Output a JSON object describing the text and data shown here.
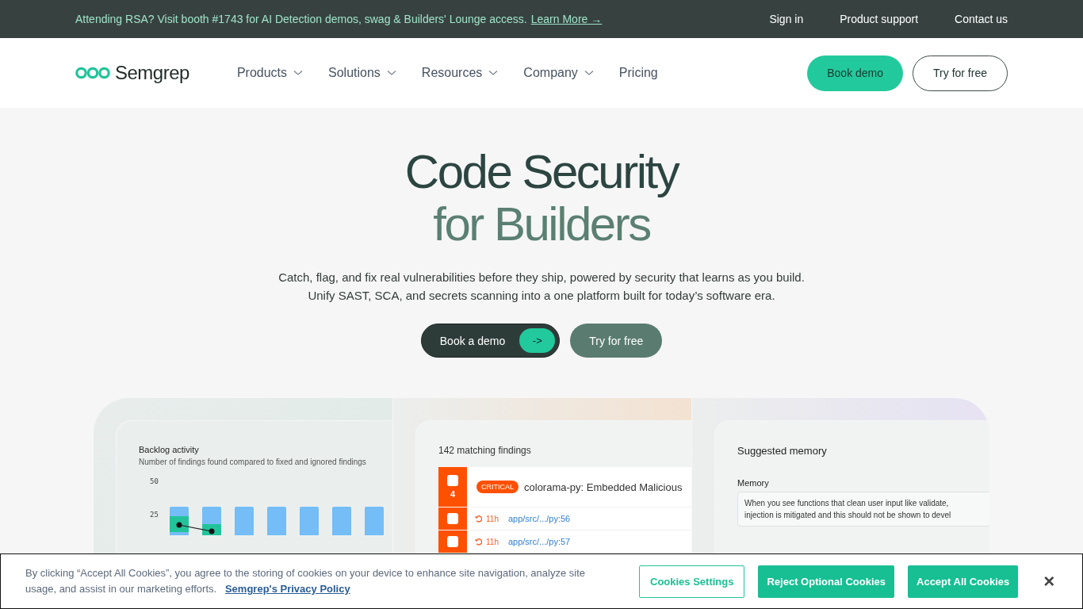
{
  "announcement": {
    "text": "Attending RSA? Visit booth #1743 for AI Detection demos, swag & Builders' Lounge access.",
    "link": "Learn More →"
  },
  "top_links": [
    "Sign in",
    "Product support",
    "Contact us"
  ],
  "brand": "Semgrep",
  "nav": [
    {
      "label": "Products",
      "dropdown": true
    },
    {
      "label": "Solutions",
      "dropdown": true
    },
    {
      "label": "Resources",
      "dropdown": true
    },
    {
      "label": "Company",
      "dropdown": true
    },
    {
      "label": "Pricing",
      "dropdown": false
    }
  ],
  "nav_buttons": {
    "primary": "Book demo",
    "secondary": "Try for free"
  },
  "hero": {
    "title_line_1": "Code Security",
    "title_line_2": "for Builders",
    "subtitle_line_1": "Catch, flag, and fix real vulnerabilities before they ship, powered by security that learns as you build.",
    "subtitle_line_2": "Unify SAST, SCA, and secrets scanning into a one platform built for today’s software era.",
    "primary_button": "Book a demo",
    "primary_arrow": "->",
    "secondary_button": "Try for free"
  },
  "backlog": {
    "title": "Backlog activity",
    "subtitle": "Number of findings found compared to fixed and ignored findings",
    "y_ticks": [
      "50",
      "25"
    ]
  },
  "findings": {
    "title": "142 matching findings",
    "group": {
      "checked": false,
      "count": "4",
      "severity": "CRITICAL",
      "name": "colorama-py: Embedded Malicious"
    },
    "rows": [
      {
        "checked": false,
        "age": "11h",
        "path": "app/src/.../py:56"
      },
      {
        "checked": false,
        "age": "11h",
        "path": "app/src/.../py:57"
      }
    ]
  },
  "memory": {
    "title": "Suggested memory",
    "label": "Memory",
    "text_line_1": "When you see functions that clean user input like validate,",
    "text_line_2": "injection is mitigated and this should not be shown to devel"
  },
  "cookie_banner": {
    "text": "By clicking “Accept All Cookies”, you agree to the storing of cookies on your device to enhance site navigation, analyze site usage, and assist in our marketing efforts.",
    "link": "Semgrep's Privacy Policy",
    "settings_button": "Cookies Settings",
    "reject_button": "Reject Optional Cookies",
    "accept_button": "Accept All Cookies",
    "close": "×"
  }
}
